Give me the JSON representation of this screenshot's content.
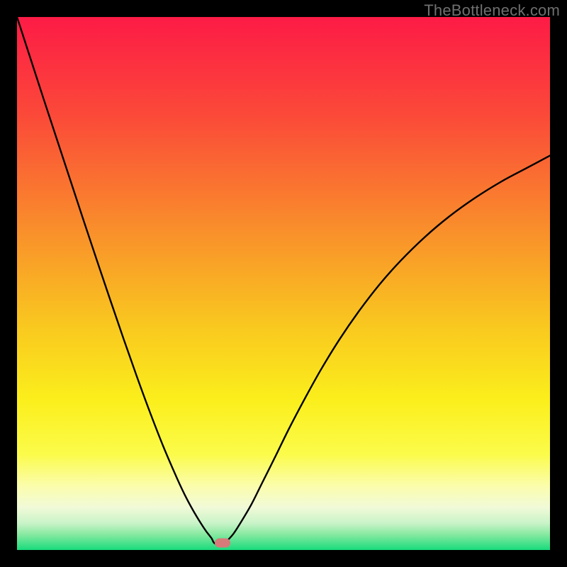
{
  "watermark": "TheBottleneck.com",
  "plot": {
    "inner_left": 24,
    "inner_top": 24,
    "inner_width": 752,
    "inner_height": 752
  },
  "gradient_stops": [
    {
      "pct": 0,
      "color": "#fd1b46"
    },
    {
      "pct": 18,
      "color": "#fb4839"
    },
    {
      "pct": 40,
      "color": "#f98f2b"
    },
    {
      "pct": 58,
      "color": "#f9c81f"
    },
    {
      "pct": 72,
      "color": "#fbef1c"
    },
    {
      "pct": 82,
      "color": "#fbfb4a"
    },
    {
      "pct": 88,
      "color": "#fbfdac"
    },
    {
      "pct": 92,
      "color": "#f1fad8"
    },
    {
      "pct": 95,
      "color": "#c9f3c8"
    },
    {
      "pct": 97,
      "color": "#8aeaa2"
    },
    {
      "pct": 100,
      "color": "#19db7c"
    }
  ],
  "marker": {
    "x_rel": 0.385,
    "y_rel": 0.987,
    "color": "#d77a7a"
  },
  "chart_data": {
    "type": "line",
    "title": "",
    "xlabel": "",
    "ylabel": "",
    "xlim": [
      0,
      100
    ],
    "ylim": [
      0,
      100
    ],
    "y_inverted_meaning": "lower y = better (green at bottom)",
    "series": [
      {
        "name": "bottleneck-curve",
        "x": [
          0.0,
          2.5,
          5.0,
          7.5,
          10.0,
          12.5,
          15.0,
          17.5,
          20.0,
          22.5,
          25.0,
          27.5,
          30.0,
          31.5,
          33.0,
          34.5,
          35.5,
          36.5,
          37.0,
          38.0,
          39.0,
          40.5,
          42.0,
          44.0,
          46.0,
          48.5,
          51.0,
          54.0,
          57.0,
          60.5,
          64.0,
          68.0,
          72.0,
          76.5,
          81.0,
          86.0,
          91.0,
          95.5,
          100.0
        ],
        "y": [
          100.0,
          92.3,
          84.6,
          77.0,
          69.4,
          61.8,
          54.3,
          46.9,
          39.6,
          32.5,
          25.7,
          19.3,
          13.5,
          10.3,
          7.5,
          5.0,
          3.5,
          2.2,
          1.3,
          1.0,
          1.4,
          2.9,
          5.2,
          8.6,
          12.6,
          17.6,
          22.7,
          28.4,
          33.8,
          39.5,
          44.6,
          49.8,
          54.3,
          58.7,
          62.5,
          66.1,
          69.2,
          71.6,
          74.0
        ]
      }
    ],
    "annotations": [
      {
        "name": "optimum-marker",
        "x": 38.5,
        "y": 1.3
      }
    ]
  }
}
